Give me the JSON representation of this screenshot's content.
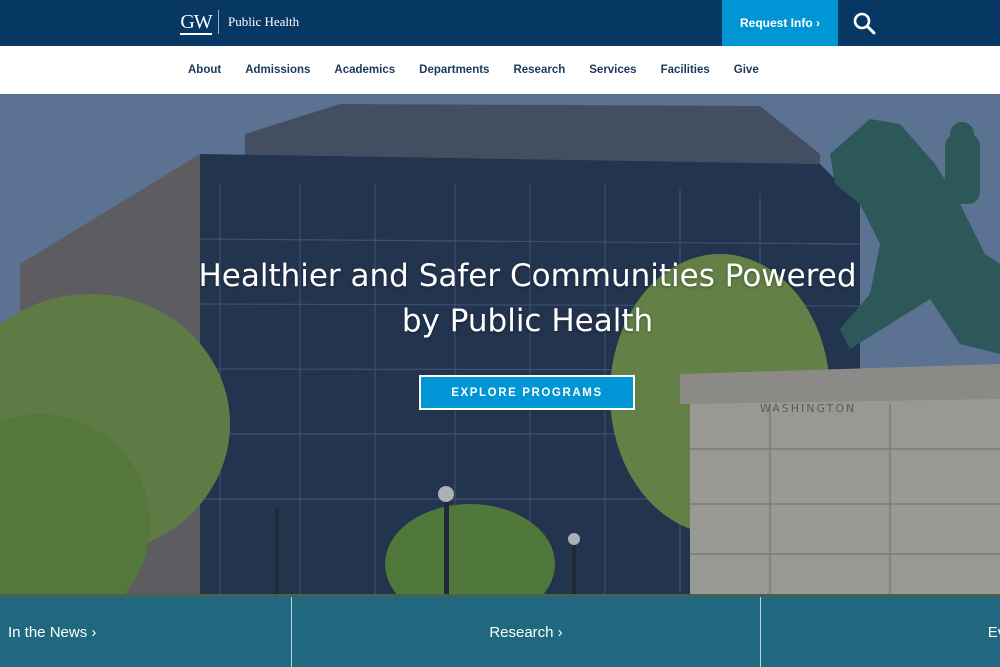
{
  "header": {
    "brand_logo": "GW",
    "brand_name": "Public Health",
    "request_info_label": "Request Info ›",
    "search_icon": "search-icon",
    "colors": {
      "bar": "#073763",
      "accent": "#0096d6"
    }
  },
  "nav": {
    "items": [
      {
        "label": "About"
      },
      {
        "label": "Admissions"
      },
      {
        "label": "Academics"
      },
      {
        "label": "Departments"
      },
      {
        "label": "Research"
      },
      {
        "label": "Services"
      },
      {
        "label": "Facilities"
      },
      {
        "label": "Give"
      }
    ]
  },
  "hero": {
    "title_line1": "Healthier and Safer Communities Powered",
    "title_line2": "by Public Health",
    "cta_label": "EXPLORE PROGRAMS",
    "statue_inscription": "WASHINGTON"
  },
  "strip": {
    "tabs": [
      {
        "label": "In the News ›"
      },
      {
        "label": "Research ›"
      },
      {
        "label": "Even"
      }
    ]
  }
}
